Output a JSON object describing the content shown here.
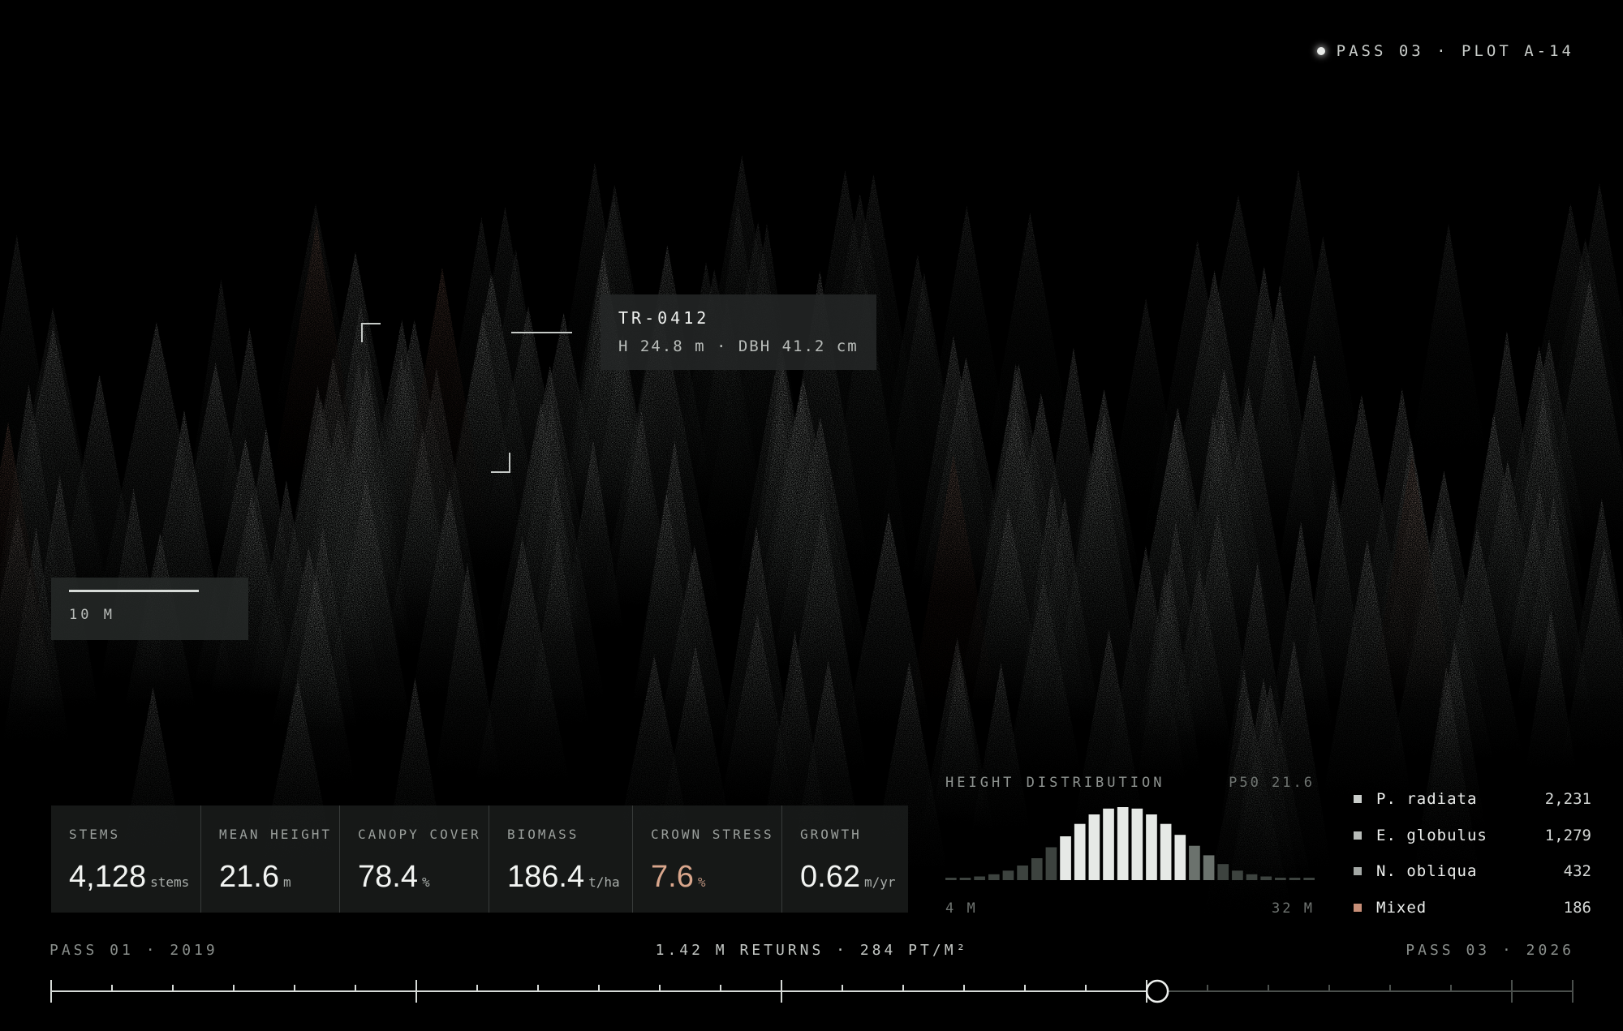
{
  "header": {
    "pass": "PASS 03",
    "separator": "·",
    "plot": "PLOT A-14",
    "text": "PASS 03 · PLOT A-14"
  },
  "tooltip": {
    "tree_id": "TR-0412",
    "info": "H 24.8 m · DBH 41.2 cm"
  },
  "scale": {
    "label": "10 M"
  },
  "metrics": [
    {
      "label": "STEMS",
      "value": "4,128",
      "unit": "stems",
      "highlight": false
    },
    {
      "label": "MEAN HEIGHT",
      "value": "21.6",
      "unit": "m",
      "highlight": false
    },
    {
      "label": "CANOPY COVER",
      "value": "78.4",
      "unit": "%",
      "highlight": false
    },
    {
      "label": "BIOMASS",
      "value": "186.4",
      "unit": "t/ha",
      "highlight": false
    },
    {
      "label": "CROWN STRESS",
      "value": "7.6",
      "unit": "%",
      "highlight": true
    },
    {
      "label": "GROWTH",
      "value": "0.62",
      "unit": "m/yr",
      "highlight": false
    }
  ],
  "histogram": {
    "label": "HEIGHT DISTRIBUTION",
    "p50": "P50 21.6",
    "min_label": "4 M",
    "max_label": "32 M",
    "bars": [
      0.02,
      0.03,
      0.05,
      0.08,
      0.13,
      0.2,
      0.3,
      0.45,
      0.6,
      0.77,
      0.9,
      0.98,
      1.0,
      0.98,
      0.9,
      0.77,
      0.62,
      0.47,
      0.34,
      0.22,
      0.13,
      0.08,
      0.05,
      0.03,
      0.02,
      0.02
    ],
    "highlight_range": [
      8,
      18
    ],
    "colors": {
      "low": "#3d433f",
      "mid": "#6b726d",
      "high": "#e6e9e6"
    }
  },
  "legend": [
    {
      "species": "P. radiata",
      "count": "2,231",
      "color": "#c9cdca"
    },
    {
      "species": "E. globulus",
      "count": "1,279",
      "color": "#b8bcb9"
    },
    {
      "species": "N. obliqua",
      "count": "432",
      "color": "#a3a8a5"
    },
    {
      "species": "Mixed",
      "count": "186",
      "color": "#c88f78"
    }
  ],
  "timeline": {
    "start": "PASS 01 · 2019",
    "summary": "1.42 M RETURNS · 284 PT/M²",
    "end": "PASS 03 · 2026",
    "position": 0.727
  },
  "colors": {
    "background": "#000000",
    "tree": "#e8ece9",
    "tree_stress": "#c98e78",
    "accent": "#d9a68c"
  }
}
